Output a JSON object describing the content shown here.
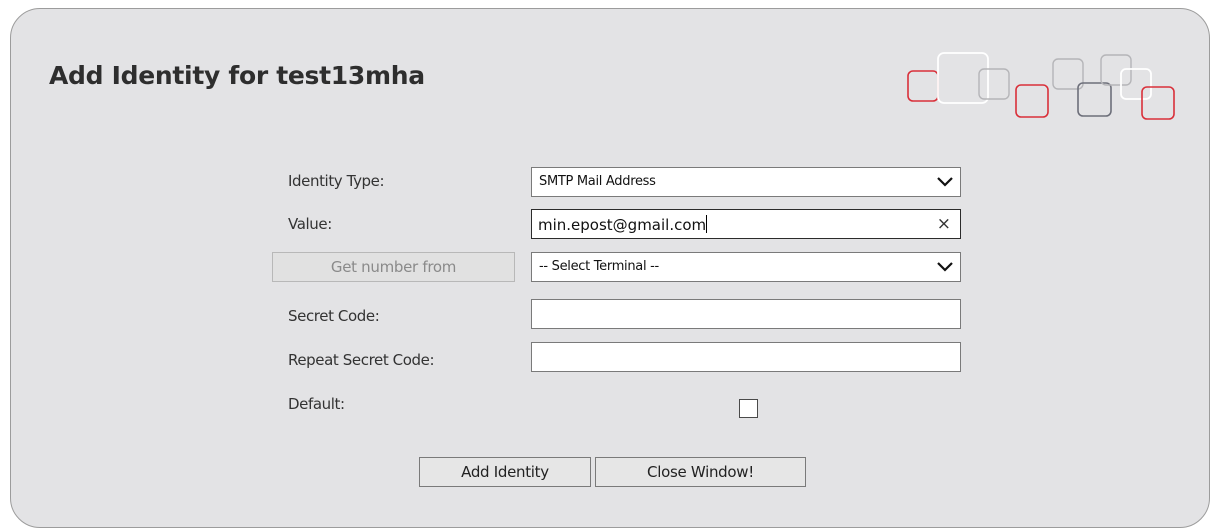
{
  "dialog": {
    "title": "Add Identity for test13mha"
  },
  "form": {
    "identity_type": {
      "label": "Identity Type:",
      "selected": "SMTP Mail Address"
    },
    "value": {
      "label": "Value:",
      "text": "min.epost@gmail.com"
    },
    "terminal": {
      "button_label": "Get number from",
      "selected": "-- Select Terminal --"
    },
    "secret_code": {
      "label": "Secret Code:",
      "value": ""
    },
    "repeat_secret_code": {
      "label": "Repeat Secret Code:",
      "value": ""
    },
    "default": {
      "label": "Default:",
      "checked": false
    }
  },
  "buttons": {
    "add_identity": "Add Identity",
    "close_window": "Close Window!"
  },
  "colors": {
    "panel_background": "#e3e3e5",
    "decoration_red": "#d9303a",
    "decoration_white": "#ffffff",
    "decoration_gray": "#6d6f7a"
  }
}
